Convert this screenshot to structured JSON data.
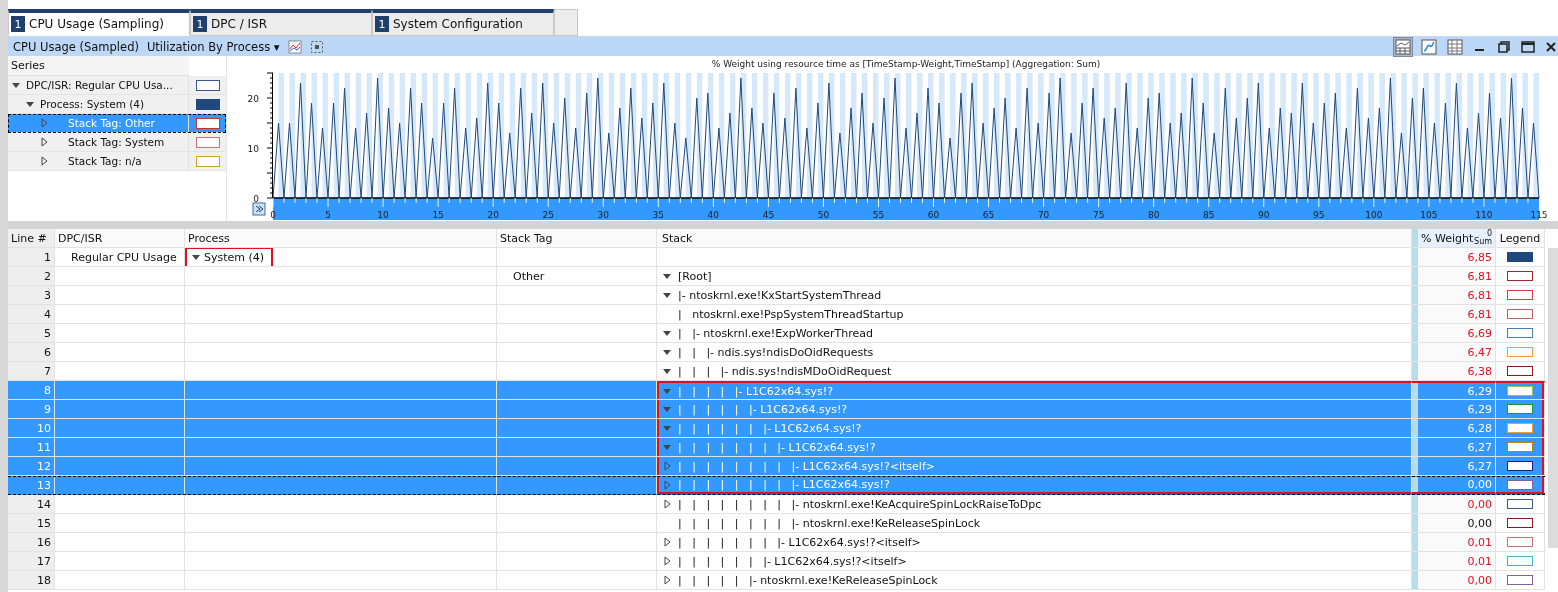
{
  "tabs": [
    {
      "badge": "1",
      "label": "CPU Usage (Sampling)",
      "selected": true
    },
    {
      "badge": "1",
      "label": "DPC / ISR",
      "selected": false
    },
    {
      "badge": "1",
      "label": "System Configuration",
      "selected": false
    }
  ],
  "toolbar": {
    "graph_title": "CPU Usage (Sampled)",
    "preset": "Utilization By Process",
    "preset_caret": "▾"
  },
  "series": {
    "header": "Series",
    "items": [
      {
        "label": "DPC/ISR: Regular CPU Usa...",
        "expanded": true,
        "selected": false,
        "filled": false,
        "color": "#3a5a8a",
        "children": [
          {
            "label": "Process: System (4)",
            "expanded": true,
            "selected": false,
            "filled": true,
            "color": "#1f497d",
            "children": [
              {
                "label": "Stack Tag: Other",
                "expanded": false,
                "selected": true,
                "filled": false,
                "color": "#c0392b"
              },
              {
                "label": "Stack Tag: System",
                "expanded": false,
                "selected": false,
                "filled": false,
                "color": "#d07070"
              },
              {
                "label": "Stack Tag: n/a",
                "expanded": false,
                "selected": false,
                "filled": false,
                "color": "#d4a020"
              }
            ]
          }
        ]
      }
    ]
  },
  "chart": {
    "chart_data": {
      "type": "line",
      "title": "% Weight using resource time as [TimeStamp-Weight,TimeStamp] (Aggregation: Sum)",
      "xlim": [
        0,
        115
      ],
      "ylim": [
        0,
        25
      ],
      "xticks": [
        0,
        5,
        10,
        15,
        20,
        25,
        30,
        35,
        40,
        45,
        50,
        55,
        60,
        65,
        70,
        75,
        80,
        85,
        90,
        95,
        100,
        105,
        110,
        115
      ],
      "yticks": [
        0,
        10,
        20
      ],
      "x": [
        0,
        0.5,
        1,
        1.5,
        2,
        2.5,
        3,
        3.5,
        4,
        4.5,
        5,
        5.5,
        6,
        6.5,
        7,
        7.5,
        8,
        8.5,
        9,
        9.5,
        10,
        10.5,
        11,
        11.5,
        12,
        12.5,
        13,
        13.5,
        14,
        14.5,
        15,
        15.5,
        16,
        16.5,
        17,
        17.5,
        18,
        18.5,
        19,
        19.5,
        20,
        20.5,
        21,
        21.5,
        22,
        22.5,
        23,
        23.5,
        24,
        24.5,
        25,
        25.5,
        26,
        26.5,
        27,
        27.5,
        28,
        28.5,
        29,
        29.5,
        30,
        30.5,
        31,
        31.5,
        32,
        32.5,
        33,
        33.5,
        34,
        34.5,
        35,
        35.5,
        36,
        36.5,
        37,
        37.5,
        38,
        38.5,
        39,
        39.5,
        40,
        40.5,
        41,
        41.5,
        42,
        42.5,
        43,
        43.5,
        44,
        44.5,
        45,
        45.5,
        46,
        46.5,
        47,
        47.5,
        48,
        48.5,
        49,
        49.5,
        50,
        50.5,
        51,
        51.5,
        52,
        52.5,
        53,
        53.5,
        54,
        54.5,
        55,
        55.5,
        56,
        56.5,
        57,
        57.5,
        58,
        58.5,
        59,
        59.5,
        60,
        60.5,
        61,
        61.5,
        62,
        62.5,
        63,
        63.5,
        64,
        64.5,
        65,
        65.5,
        66,
        66.5,
        67,
        67.5,
        68,
        68.5,
        69,
        69.5,
        70,
        70.5,
        71,
        71.5,
        72,
        72.5,
        73,
        73.5,
        74,
        74.5,
        75,
        75.5,
        76,
        76.5,
        77,
        77.5,
        78,
        78.5,
        79,
        79.5,
        80,
        80.5,
        81,
        81.5,
        82,
        82.5,
        83,
        83.5,
        84,
        84.5,
        85,
        85.5,
        86,
        86.5,
        87,
        87.5,
        88,
        88.5,
        89,
        89.5,
        90,
        90.5,
        91,
        91.5,
        92,
        92.5,
        93,
        93.5,
        94,
        94.5,
        95,
        95.5,
        96,
        96.5,
        97,
        97.5,
        98,
        98.5,
        99,
        99.5,
        100,
        100.5,
        101,
        101.5,
        102,
        102.5,
        103,
        103.5,
        104,
        104.5,
        105,
        105.5,
        106,
        106.5,
        107,
        107.5,
        108,
        108.5,
        109,
        109.5,
        110,
        110.5,
        111,
        111.5,
        112,
        112.5,
        113,
        113.5,
        114,
        114.5,
        115
      ],
      "series": [
        {
          "color": "#1f497d",
          "values": [
            0,
            15,
            0,
            15,
            0,
            23,
            0,
            19,
            0,
            14,
            0,
            19,
            0,
            22,
            0,
            14,
            0,
            17,
            0,
            24,
            0,
            18,
            0,
            15,
            0,
            22,
            0,
            19,
            0,
            12,
            0,
            19,
            0,
            22,
            0,
            14,
            0,
            16,
            0,
            23,
            0,
            19,
            0,
            13,
            0,
            22,
            0,
            17,
            0,
            23,
            0,
            15,
            0,
            20,
            0,
            14,
            0,
            21,
            0,
            24,
            0,
            13,
            0,
            18,
            0,
            22,
            0,
            16,
            0,
            19,
            0,
            23,
            0,
            15,
            0,
            12,
            0,
            20,
            0,
            21,
            0,
            14,
            0,
            17,
            0,
            24,
            0,
            18,
            0,
            15,
            0,
            21,
            0,
            16,
            0,
            22,
            0,
            14,
            0,
            19,
            0,
            23,
            0,
            13,
            0,
            18,
            0,
            21,
            0,
            15,
            0,
            20,
            0,
            24,
            0,
            14,
            0,
            17,
            0,
            22,
            0,
            19,
            0,
            12,
            0,
            21,
            0,
            23,
            0,
            15,
            0,
            18,
            0,
            20,
            0,
            14,
            0,
            22,
            0,
            15,
            0,
            21,
            0,
            24,
            0,
            13,
            0,
            19,
            0,
            22,
            0,
            16,
            0,
            18,
            0,
            23,
            0,
            14,
            0,
            20,
            0,
            21,
            0,
            15,
            0,
            17,
            0,
            24,
            0,
            19,
            0,
            13,
            0,
            22,
            0,
            16,
            0,
            20,
            0,
            23,
            0,
            14,
            0,
            18,
            0,
            17,
            0,
            23,
            0,
            15,
            0,
            19,
            0,
            21,
            0,
            14,
            0,
            22,
            0,
            16,
            0,
            18,
            0,
            24,
            0,
            13,
            0,
            20,
            0,
            22,
            0,
            15,
            0,
            19,
            0,
            23,
            0,
            14,
            0,
            17,
            0,
            21,
            0,
            16,
            0,
            24,
            0,
            18,
            0,
            15,
            0
          ]
        }
      ]
    }
  },
  "table": {
    "columns": [
      "Line #",
      "DPC/ISR",
      "Process",
      "Stack Tag",
      "Stack",
      "% Weight",
      "Legend"
    ],
    "weight_sort_note": "Sum",
    "weight_sort_index": "0",
    "rows": [
      {
        "line": "1",
        "dpc": "Regular CPU Usage",
        "process": "System (4)",
        "process_expanded": true,
        "process_marked": true,
        "weight": "6,85",
        "weight_red": true,
        "filled": true,
        "color": "#1f497d",
        "selected": false,
        "focused": false,
        "boxed": false
      },
      {
        "line": "2",
        "stack_tag": "Other",
        "expandable": true,
        "expanded": true,
        "stack": "[Root]",
        "weight": "6,81",
        "weight_red": true,
        "filled": false,
        "color": "#a52a2a",
        "selected": false,
        "focused": false,
        "boxed": false
      },
      {
        "line": "3",
        "expandable": true,
        "expanded": true,
        "stack": "|- ntoskrnl.exe!KxStartSystemThread",
        "weight": "6,81",
        "weight_red": true,
        "filled": false,
        "color": "#d04040",
        "selected": false,
        "focused": false,
        "boxed": false
      },
      {
        "line": "4",
        "stack": "|   ntoskrnl.exe!PspSystemThreadStartup",
        "weight": "6,81",
        "weight_red": true,
        "filled": false,
        "color": "#c06060",
        "selected": false,
        "focused": false,
        "boxed": false
      },
      {
        "line": "5",
        "expandable": true,
        "expanded": true,
        "stack": "|   |- ntoskrnl.exe!ExpWorkerThread",
        "weight": "6,69",
        "weight_red": true,
        "filled": false,
        "color": "#4a7ebb",
        "selected": false,
        "focused": false,
        "boxed": false
      },
      {
        "line": "6",
        "expandable": true,
        "expanded": true,
        "stack": "|   |   |- ndis.sys!ndisDoOidRequests",
        "weight": "6,47",
        "weight_red": true,
        "filled": false,
        "color": "#f79646",
        "selected": false,
        "focused": false,
        "boxed": false
      },
      {
        "line": "7",
        "expandable": true,
        "expanded": true,
        "stack": "|   |   |   |- ndis.sys!ndisMDoOidRequest",
        "weight": "6,38",
        "weight_red": true,
        "filled": false,
        "color": "#8b1a1a",
        "selected": false,
        "focused": false,
        "boxed": false
      },
      {
        "line": "8",
        "expandable": true,
        "expanded": true,
        "stack": "|   |   |   |   |- L1C62x64.sys!?",
        "weight": "6,29",
        "weight_red": false,
        "filled": false,
        "color": "#9bbb59",
        "selected": true,
        "focused": false,
        "boxed": true
      },
      {
        "line": "9",
        "expandable": true,
        "expanded": true,
        "stack": "|   |   |   |   |   |- L1C62x64.sys!?",
        "weight": "6,29",
        "weight_red": false,
        "filled": false,
        "color": "#1a9a3a",
        "selected": true,
        "focused": false,
        "boxed": true
      },
      {
        "line": "10",
        "expandable": true,
        "expanded": true,
        "stack": "|   |   |   |   |   |   |- L1C62x64.sys!?",
        "weight": "6,28",
        "weight_red": false,
        "filled": false,
        "color": "#e8a040",
        "selected": true,
        "focused": false,
        "boxed": true
      },
      {
        "line": "11",
        "expandable": true,
        "expanded": true,
        "stack": "|   |   |   |   |   |   |   |- L1C62x64.sys!?",
        "weight": "6,27",
        "weight_red": false,
        "filled": false,
        "color": "#b8860b",
        "selected": true,
        "focused": false,
        "boxed": true
      },
      {
        "line": "12",
        "expandable": true,
        "expanded": false,
        "stack": "|   |   |   |   |   |   |   |   |- L1C62x64.sys!?<itself>",
        "weight": "6,27",
        "weight_red": false,
        "filled": false,
        "color": "#1a1a8a",
        "selected": true,
        "focused": false,
        "boxed": true
      },
      {
        "line": "13",
        "expandable": true,
        "expanded": false,
        "stack": "|   |   |   |   |   |   |   |   |- L1C62x64.sys!?",
        "weight": "0,00",
        "weight_red": false,
        "filled": false,
        "color": "#8064a2",
        "selected": true,
        "focused": true,
        "boxed": true
      },
      {
        "line": "14",
        "expandable": true,
        "expanded": false,
        "stack": "|   |   |   |   |   |   |   |   |- ntoskrnl.exe!KeAcquireSpinLockRaiseToDpc",
        "weight": "0,00",
        "weight_red": true,
        "filled": false,
        "color": "#3a5a8a",
        "selected": false,
        "focused": false,
        "boxed": false
      },
      {
        "line": "15",
        "stack": "|   |   |   |   |   |   |   |   |- ntoskrnl.exe!KeReleaseSpinLock",
        "weight": "0,00",
        "weight_red": false,
        "filled": false,
        "color": "#8b1a1a",
        "selected": false,
        "focused": false,
        "boxed": false
      },
      {
        "line": "16",
        "expandable": true,
        "expanded": false,
        "stack": "|   |   |   |   |   |   |   |- L1C62x64.sys!?<itself>",
        "weight": "0,01",
        "weight_red": true,
        "filled": false,
        "color": "#d07070",
        "selected": false,
        "focused": false,
        "boxed": false
      },
      {
        "line": "17",
        "expandable": true,
        "expanded": false,
        "stack": "|   |   |   |   |   |   |- L1C62x64.sys!?<itself>",
        "weight": "0,01",
        "weight_red": true,
        "filled": false,
        "color": "#4bacc6",
        "selected": false,
        "focused": false,
        "boxed": false
      },
      {
        "line": "18",
        "expandable": true,
        "expanded": false,
        "stack": "|   |   |   |   |   |- ntoskrnl.exe!KeReleaseSpinLock",
        "weight": "0,00",
        "weight_red": true,
        "filled": false,
        "color": "#8064a2",
        "selected": false,
        "focused": false,
        "boxed": false
      }
    ]
  }
}
